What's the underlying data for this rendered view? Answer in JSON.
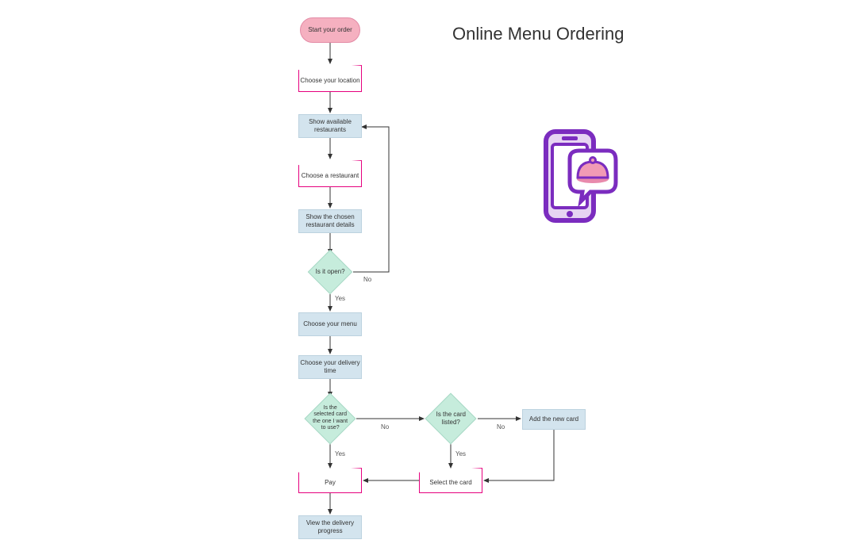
{
  "title": "Online Menu Ordering",
  "nodes": {
    "start": "Start your order",
    "choose_location": "Choose your location",
    "show_restaurants": "Show available restaurants",
    "choose_restaurant": "Choose a restaurant",
    "show_details": "Show the chosen restaurant details",
    "is_open": "Is it open?",
    "choose_menu": "Choose your menu",
    "choose_time": "Choose your delivery time",
    "card_selected": "Is the selected card the one I want to use?",
    "card_listed": "Is the card listed?",
    "add_card": "Add the new card",
    "select_card": "Select the card",
    "pay": "Pay",
    "view_progress": "View the delivery progress"
  },
  "edge_labels": {
    "yes": "Yes",
    "no": "No"
  },
  "flow": {
    "description": "Flowchart for an online menu ordering process.",
    "edges": [
      {
        "from": "start",
        "to": "choose_location"
      },
      {
        "from": "choose_location",
        "to": "show_restaurants"
      },
      {
        "from": "show_restaurants",
        "to": "choose_restaurant"
      },
      {
        "from": "choose_restaurant",
        "to": "show_details"
      },
      {
        "from": "show_details",
        "to": "is_open"
      },
      {
        "from": "is_open",
        "to": "choose_menu",
        "label": "Yes"
      },
      {
        "from": "is_open",
        "to": "show_restaurants",
        "label": "No"
      },
      {
        "from": "choose_menu",
        "to": "choose_time"
      },
      {
        "from": "choose_time",
        "to": "card_selected"
      },
      {
        "from": "card_selected",
        "to": "pay",
        "label": "Yes"
      },
      {
        "from": "card_selected",
        "to": "card_listed",
        "label": "No"
      },
      {
        "from": "card_listed",
        "to": "select_card",
        "label": "Yes"
      },
      {
        "from": "card_listed",
        "to": "add_card",
        "label": "No"
      },
      {
        "from": "add_card",
        "to": "select_card"
      },
      {
        "from": "select_card",
        "to": "pay"
      },
      {
        "from": "pay",
        "to": "view_progress"
      }
    ]
  },
  "icon": {
    "name": "phone-food-order-icon",
    "colors": {
      "phone_outline": "#7b2cbf",
      "bubble_fill": "#ffffff",
      "dish_fill": "#f19ab5",
      "dish_lid": "#e88aac"
    }
  },
  "chart_data": {
    "type": "flowchart",
    "title": "Online Menu Ordering",
    "nodes": [
      {
        "id": "start",
        "shape": "terminator",
        "label": "Start your order"
      },
      {
        "id": "choose_location",
        "shape": "manual-input",
        "label": "Choose your location"
      },
      {
        "id": "show_restaurants",
        "shape": "process",
        "label": "Show available restaurants"
      },
      {
        "id": "choose_restaurant",
        "shape": "manual-input",
        "label": "Choose a restaurant"
      },
      {
        "id": "show_details",
        "shape": "process",
        "label": "Show the chosen restaurant details"
      },
      {
        "id": "is_open",
        "shape": "decision",
        "label": "Is it open?"
      },
      {
        "id": "choose_menu",
        "shape": "process",
        "label": "Choose your menu"
      },
      {
        "id": "choose_time",
        "shape": "process",
        "label": "Choose your delivery time"
      },
      {
        "id": "card_selected",
        "shape": "decision",
        "label": "Is the selected card the one I want to use?"
      },
      {
        "id": "card_listed",
        "shape": "decision",
        "label": "Is the card listed?"
      },
      {
        "id": "add_card",
        "shape": "process",
        "label": "Add the new card"
      },
      {
        "id": "select_card",
        "shape": "manual-input",
        "label": "Select the card"
      },
      {
        "id": "pay",
        "shape": "manual-input",
        "label": "Pay"
      },
      {
        "id": "view_progress",
        "shape": "process",
        "label": "View the delivery progress"
      }
    ],
    "edges": [
      {
        "from": "start",
        "to": "choose_location"
      },
      {
        "from": "choose_location",
        "to": "show_restaurants"
      },
      {
        "from": "show_restaurants",
        "to": "choose_restaurant"
      },
      {
        "from": "choose_restaurant",
        "to": "show_details"
      },
      {
        "from": "show_details",
        "to": "is_open"
      },
      {
        "from": "is_open",
        "to": "choose_menu",
        "label": "Yes"
      },
      {
        "from": "is_open",
        "to": "show_restaurants",
        "label": "No"
      },
      {
        "from": "choose_menu",
        "to": "choose_time"
      },
      {
        "from": "choose_time",
        "to": "card_selected"
      },
      {
        "from": "card_selected",
        "to": "pay",
        "label": "Yes"
      },
      {
        "from": "card_selected",
        "to": "card_listed",
        "label": "No"
      },
      {
        "from": "card_listed",
        "to": "select_card",
        "label": "Yes"
      },
      {
        "from": "card_listed",
        "to": "add_card",
        "label": "No"
      },
      {
        "from": "add_card",
        "to": "select_card"
      },
      {
        "from": "select_card",
        "to": "pay"
      },
      {
        "from": "pay",
        "to": "view_progress"
      }
    ]
  }
}
